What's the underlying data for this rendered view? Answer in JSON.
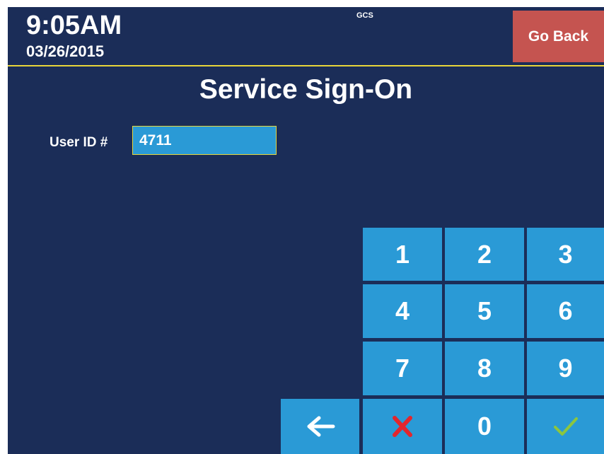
{
  "header": {
    "time": "9:05AM",
    "date": "03/26/2015",
    "system_label": "GCS",
    "go_back_label": "Go Back"
  },
  "title": "Service Sign-On",
  "user_id": {
    "label": "User ID #",
    "value": "4711"
  },
  "keypad": {
    "keys": [
      "1",
      "2",
      "3",
      "4",
      "5",
      "6",
      "7",
      "8",
      "9",
      "0"
    ],
    "backspace_icon": "left-arrow-icon",
    "clear_icon": "red-x-icon",
    "enter_icon": "green-check-icon"
  },
  "colors": {
    "background": "#1b2d58",
    "key": "#2a9ad6",
    "go_back": "#c55450",
    "accent_line": "#e8d63a",
    "clear": "#e3262d",
    "enter": "#8cc63f"
  }
}
